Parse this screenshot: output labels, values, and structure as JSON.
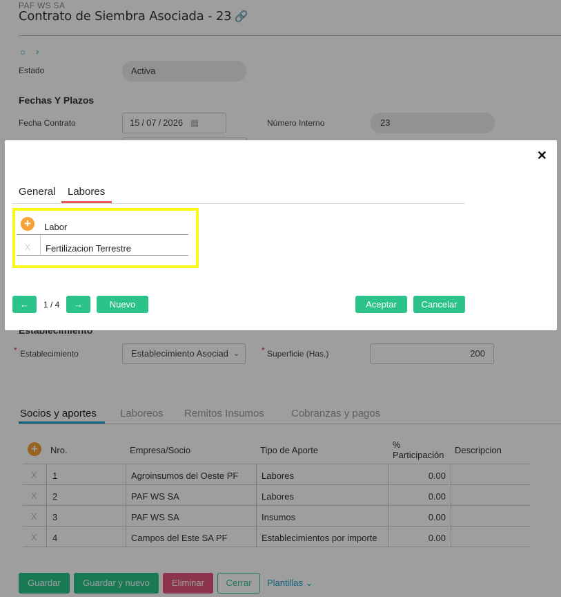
{
  "header": {
    "company": "PAF WS SA",
    "title": "Contrato de Siembra Asociada - 23",
    "link_icon": "link-icon"
  },
  "estado": {
    "label": "Estado",
    "value": "Activa"
  },
  "fechas": {
    "section_title": "Fechas Y Plazos",
    "fecha_contrato_label": "Fecha Contrato",
    "fecha_day": "15",
    "fecha_month": "07",
    "fecha_year": "2026",
    "numero_interno_label": "Número Interno",
    "numero_interno_value": "23"
  },
  "establecimiento": {
    "section_title": "Establecimiento",
    "label": "Establecimiento",
    "value": "Establecimiento Asociad",
    "superficie_label": "Superficie (Has.)",
    "superficie_value": "200"
  },
  "tabs": [
    "Socios y aportes",
    "Laboreos",
    "Remitos Insumos",
    "Cobranzas y pagos"
  ],
  "table": {
    "headers": {
      "nro": "Nro.",
      "empresa": "Empresa/Socio",
      "tipo": "Tipo de Aporte",
      "pct1": "%",
      "pct2": "Participación",
      "desc": "Descripcion"
    },
    "rows": [
      {
        "nro": "1",
        "empresa": "Agroinsumos del Oeste PF",
        "tipo": "Labores",
        "pct": "0.00",
        "x": "X"
      },
      {
        "nro": "2",
        "empresa": "PAF WS SA",
        "tipo": "Labores",
        "pct": "0.00",
        "x": "X"
      },
      {
        "nro": "3",
        "empresa": "PAF WS SA",
        "tipo": "Insumos",
        "pct": "0.00",
        "x": "X"
      },
      {
        "nro": "4",
        "empresa": "Campos del Este SA PF",
        "tipo": "Establecimientos por importe",
        "pct": "0.00",
        "x": "X"
      }
    ]
  },
  "footer_buttons": {
    "guardar": "Guardar",
    "guardar_nuevo": "Guardar y nuevo",
    "eliminar": "Eliminar",
    "cerrar": "Cerrar",
    "plantillas": "Plantillas"
  },
  "modal": {
    "close": "✕",
    "tabs": {
      "general": "General",
      "labores": "Labores"
    },
    "grid": {
      "header": "Labor",
      "row_value": "Fertilizacion Terrestre",
      "row_x": "X",
      "plus": "+"
    },
    "pager": {
      "prev": "←",
      "counter": "1 / 4",
      "next": "→",
      "nuevo": "Nuevo"
    },
    "aceptar": "Aceptar",
    "cancelar": "Cancelar"
  },
  "colors": {
    "accent_green": "#2bc38a",
    "tab_active": "#e25656",
    "highlight": "#f7f71a",
    "tab_underline_bg": "#1a9fc9"
  }
}
